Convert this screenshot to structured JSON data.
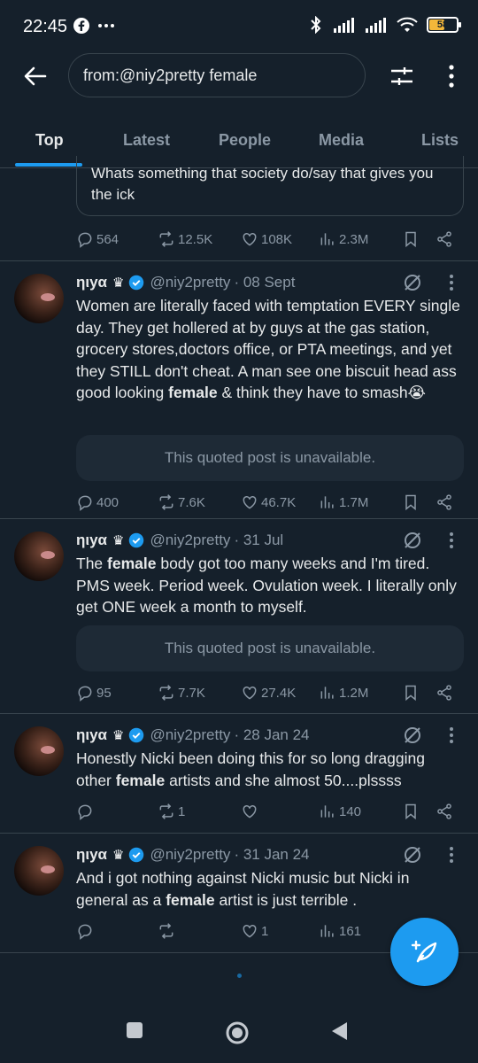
{
  "status": {
    "time": "22:45",
    "battery": "58",
    "battery_level": 0.58,
    "icons": [
      "facebook-icon",
      "more-dots-icon",
      "bluetooth-icon",
      "signal-icon",
      "signal-icon",
      "wifi-icon",
      "battery-icon"
    ]
  },
  "search": {
    "query": "from:@niy2pretty female"
  },
  "tabs": [
    {
      "label": "Top",
      "active": true
    },
    {
      "label": "Latest",
      "active": false
    },
    {
      "label": "People",
      "active": false
    },
    {
      "label": "Media",
      "active": false
    },
    {
      "label": "Lists",
      "active": false
    }
  ],
  "partial_tweet": {
    "quote_text": "Whats something that society do/say that gives you the ick",
    "replies": "564",
    "reposts": "12.5K",
    "likes": "108K",
    "views": "2.3M"
  },
  "tweets": [
    {
      "name": "ηιyα",
      "crown": "♛",
      "handle": "@niy2pretty",
      "date": "· 08 Sept",
      "text_before": "Women are literally faced with temptation EVERY single day. They get hollered at by guys at the gas station, grocery stores,doctors office, or PTA meetings, and yet they STILL don't cheat. A man see one biscuit head ass good looking ",
      "keyword": "female",
      "text_after": " & think they have to smash😭",
      "quote": "This quoted post is unavailable.",
      "replies": "400",
      "reposts": "7.6K",
      "likes": "46.7K",
      "views": "1.7M"
    },
    {
      "name": "ηιyα",
      "crown": "♛",
      "handle": "@niy2pretty",
      "date": "· 31 Jul",
      "text_before": "The ",
      "keyword": "female",
      "text_after": " body got too many weeks and I'm tired. PMS week. Period week. Ovulation week. I literally only get ONE week a month to myself.",
      "quote": "This quoted post is unavailable.",
      "replies": "95",
      "reposts": "7.7K",
      "likes": "27.4K",
      "views": "1.2M"
    },
    {
      "name": "ηιyα",
      "crown": "♛",
      "handle": "@niy2pretty",
      "date": "· 28 Jan 24",
      "text_before": "Honestly Nicki been doing this for so long  dragging other ",
      "keyword": "female",
      "text_after": " artists and she almost 50....plssss",
      "replies": "",
      "reposts": "1",
      "likes": "",
      "views": "140"
    },
    {
      "name": "ηιyα",
      "crown": "♛",
      "handle": "@niy2pretty",
      "date": "· 31 Jan 24",
      "text_before": "And i got nothing against Nicki music but Nicki in general as a ",
      "keyword": "female",
      "text_after": " artist is just terrible .",
      "replies": "",
      "reposts": "",
      "likes": "1",
      "views": "161"
    }
  ],
  "colors": {
    "background": "#15202b",
    "accent": "#1d9bf0",
    "muted": "#8b98a5",
    "border": "#38444d"
  }
}
